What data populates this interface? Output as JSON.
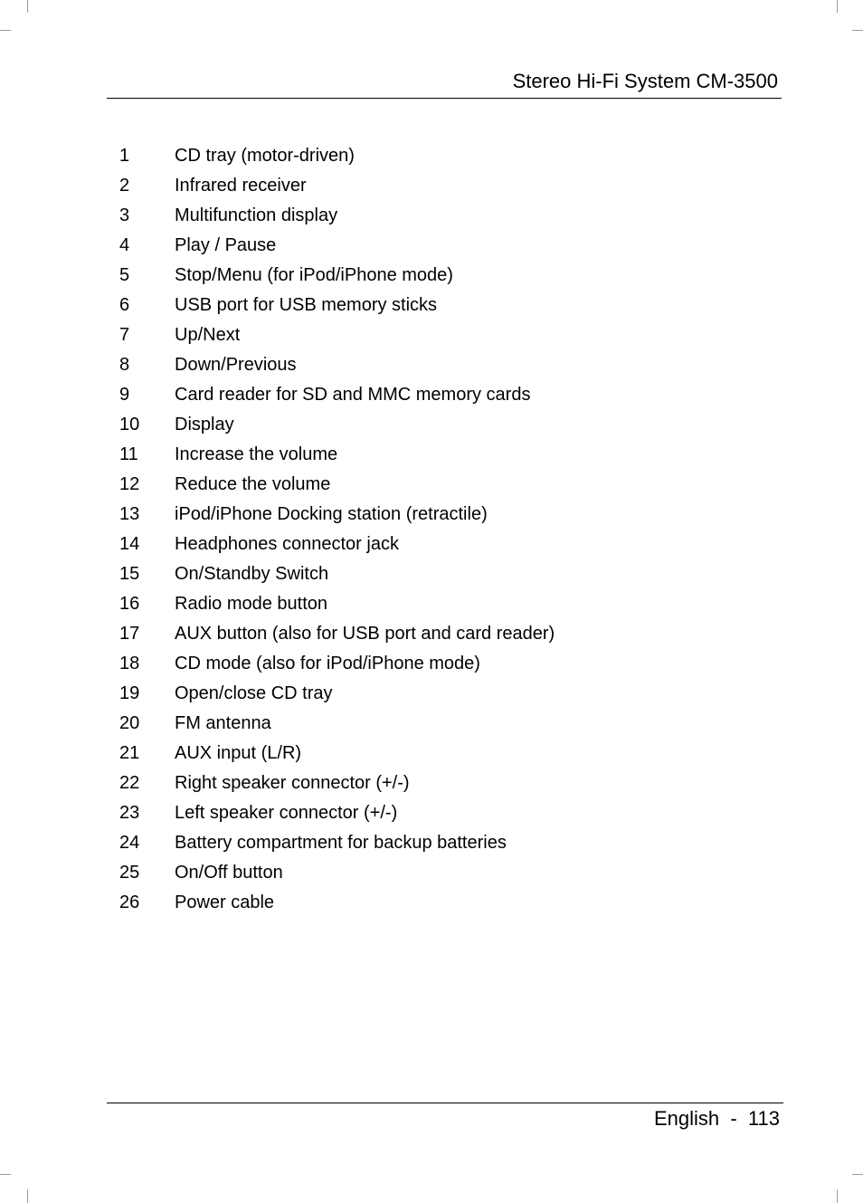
{
  "header": {
    "title": "Stereo Hi-Fi System CM-3500"
  },
  "parts_list": [
    {
      "number": "1",
      "label": "CD tray (motor-driven)"
    },
    {
      "number": "2",
      "label": "Infrared receiver"
    },
    {
      "number": "3",
      "label": "Multifunction display"
    },
    {
      "number": "4",
      "label": "Play / Pause"
    },
    {
      "number": "5",
      "label": "Stop/Menu (for iPod/iPhone mode)"
    },
    {
      "number": "6",
      "label": "USB port for USB memory sticks"
    },
    {
      "number": "7",
      "label": "Up/Next"
    },
    {
      "number": "8",
      "label": "Down/Previous"
    },
    {
      "number": "9",
      "label": "Card reader for SD and MMC memory cards"
    },
    {
      "number": "10",
      "label": "Display"
    },
    {
      "number": "11",
      "label": "Increase the volume"
    },
    {
      "number": "12",
      "label": "Reduce the volume"
    },
    {
      "number": "13",
      "label": "iPod/iPhone Docking station (retractile)"
    },
    {
      "number": "14",
      "label": "Headphones connector jack"
    },
    {
      "number": "15",
      "label": "On/Standby Switch"
    },
    {
      "number": "16",
      "label": "Radio mode button"
    },
    {
      "number": "17",
      "label": "AUX button (also for USB port and card reader)"
    },
    {
      "number": "18",
      "label": "CD mode (also for iPod/iPhone mode)"
    },
    {
      "number": "19",
      "label": "Open/close CD tray"
    },
    {
      "number": "20",
      "label": "FM antenna"
    },
    {
      "number": "21",
      "label": "AUX input (L/R)"
    },
    {
      "number": "22",
      "label": "Right speaker connector (+/-)"
    },
    {
      "number": "23",
      "label": "Left speaker connector (+/-)"
    },
    {
      "number": "24",
      "label": "Battery compartment for backup batteries"
    },
    {
      "number": "25",
      "label": "On/Off button"
    },
    {
      "number": "26",
      "label": "Power cable"
    }
  ],
  "footer": {
    "language": "English",
    "separator": "-",
    "page_number": "113"
  }
}
